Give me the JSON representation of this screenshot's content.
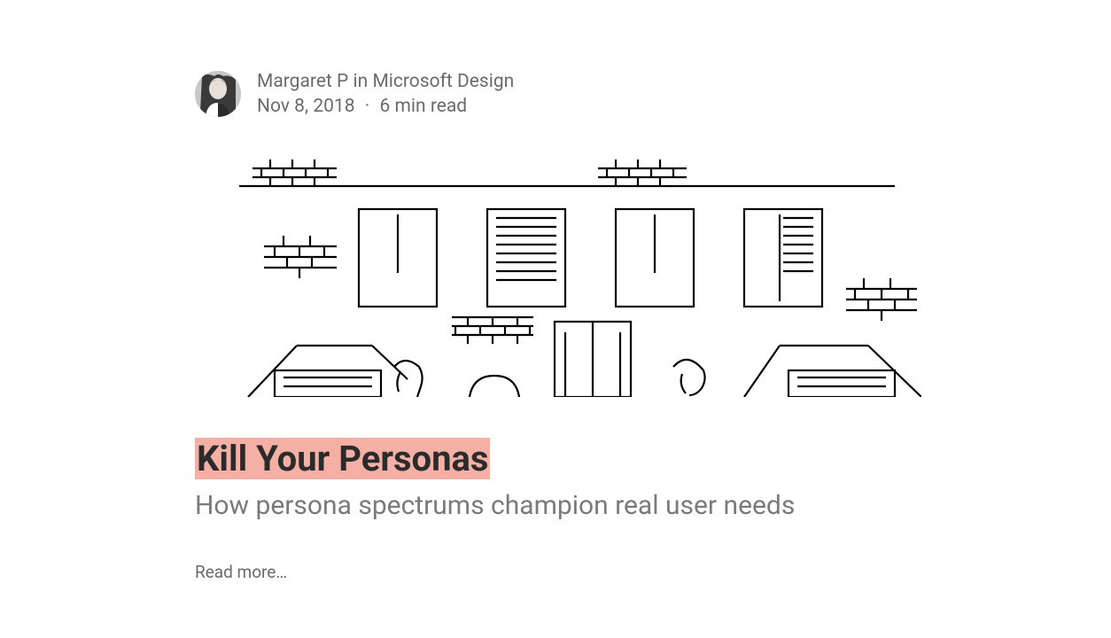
{
  "byline": {
    "author": "Margaret P",
    "in_word": "in",
    "publication": "Microsoft Design",
    "date": "Nov 8, 2018",
    "read_time": "6 min read",
    "separator": "·"
  },
  "article": {
    "title": "Kill Your Personas",
    "subtitle": "How persona spectrums champion real user needs",
    "read_more": "Read more…"
  }
}
